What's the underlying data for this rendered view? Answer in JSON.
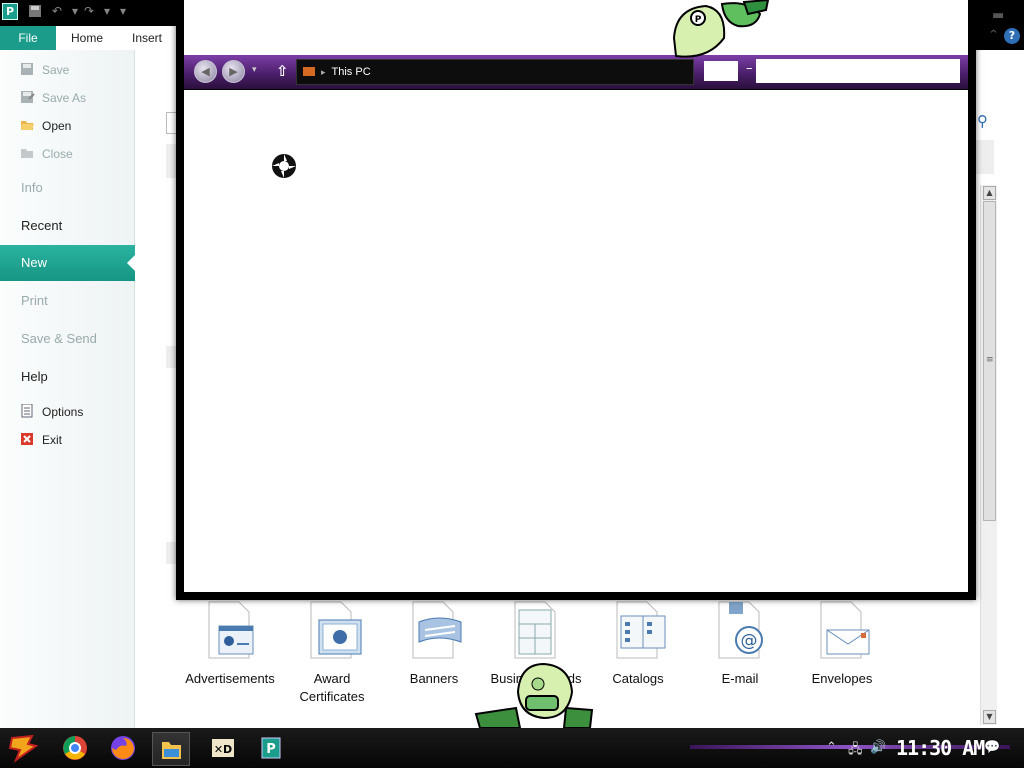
{
  "app": {
    "icon_letter": "P",
    "tabs": [
      "File",
      "Home",
      "Insert"
    ],
    "accent": "#1b9c8a"
  },
  "backstage": {
    "commands_top": [
      {
        "label": "Save",
        "icon": "save-icon",
        "enabled": false
      },
      {
        "label": "Save As",
        "icon": "save-as-icon",
        "enabled": false
      },
      {
        "label": "Open",
        "icon": "open-folder-icon",
        "enabled": true
      },
      {
        "label": "Close",
        "icon": "close-doc-icon",
        "enabled": false
      }
    ],
    "sections": [
      {
        "label": "Info",
        "enabled": false
      },
      {
        "label": "Recent",
        "enabled": true
      },
      {
        "label": "New",
        "enabled": true,
        "active": true
      },
      {
        "label": "Print",
        "enabled": false
      },
      {
        "label": "Save & Send",
        "enabled": false
      },
      {
        "label": "Help",
        "enabled": true
      }
    ],
    "commands_bottom": [
      {
        "label": "Options",
        "icon": "options-icon"
      },
      {
        "label": "Exit",
        "icon": "exit-icon"
      }
    ]
  },
  "templates": [
    {
      "label": "Advertisements"
    },
    {
      "label": "Award Certificates"
    },
    {
      "label": "Banners"
    },
    {
      "label": "Business Cards"
    },
    {
      "label": "Catalogs"
    },
    {
      "label": "E-mail"
    },
    {
      "label": "Envelopes"
    }
  ],
  "explorer": {
    "address": "This PC",
    "theme_color": "#5a2a80"
  },
  "taskbar": {
    "clock": "11:30 AM",
    "apps": [
      "start-icon",
      "chrome-icon",
      "firefox-icon",
      "file-explorer-icon",
      "xd-app-icon",
      "publisher-icon"
    ]
  }
}
